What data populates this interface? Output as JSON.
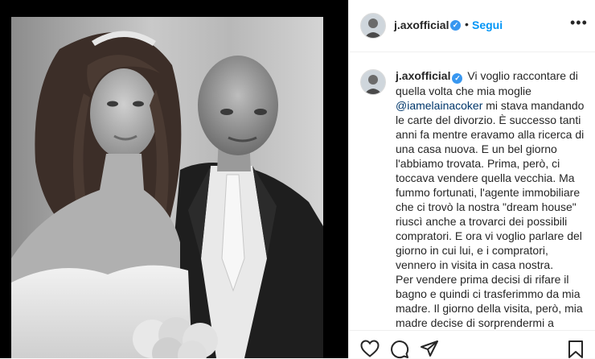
{
  "post": {
    "username": "j.axofficial",
    "follow_label": "Segui",
    "verified_mark": "✓",
    "separator": "•",
    "more_label": "•••"
  },
  "caption": {
    "username": "j.axofficial",
    "text_part1": "Vi voglio raccontare di quella volta che mia moglie",
    "mention": "@iamelainacoker",
    "text_part2": "mi stava mandando le carte del divorzio. È successo tanti anni fa mentre eravamo alla ricerca di una casa nuova. E un bel giorno l'abbiamo trovata. Prima, però, ci toccava vendere quella vecchia. Ma fummo fortunati, l'agente immobiliare che ci trovò la nostra \"dream house\" riuscì anche a trovarci dei possibili compratori. E ora vi voglio parlare del giorno in cui lui, e i compratori, vennero in visita in casa nostra.",
    "paragraph2": "Per vendere prima decisi di rifare il bagno e quindi ci trasferimmo da mia madre. Il giorno della visita, però, mia madre decise di sorprendermi a"
  },
  "icons": {
    "like": "heart-icon",
    "comment": "comment-icon",
    "share": "send-icon",
    "save": "bookmark-icon",
    "verified": "verified-badge-icon",
    "more": "more-options-icon"
  },
  "colors": {
    "link_blue": "#0095f6",
    "verified_blue": "#3897f0",
    "mention": "#00376b",
    "text": "#262626",
    "border": "#efefef"
  }
}
